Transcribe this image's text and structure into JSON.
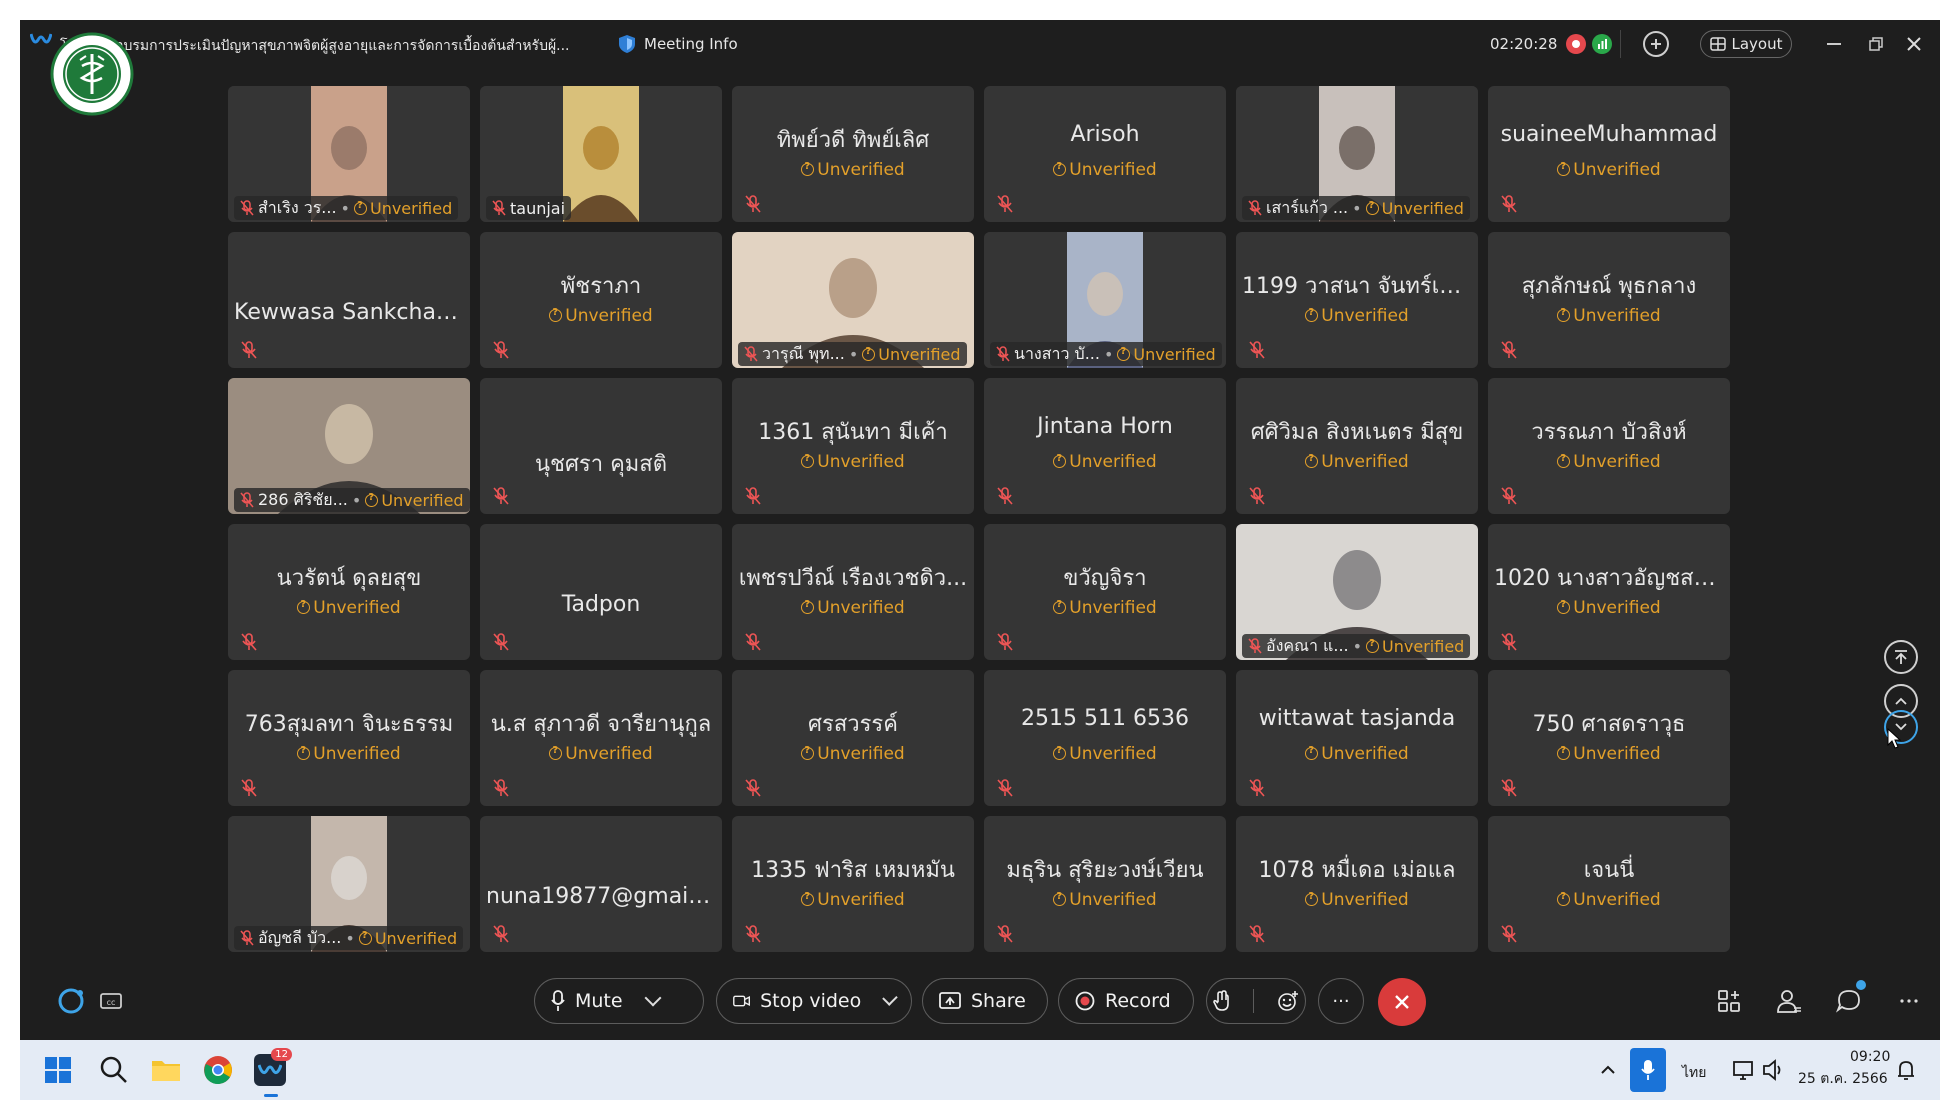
{
  "window": {
    "title": "โครงการอบรมการประเมินปัญหาสุขภาพจิตผู้สูงอายุและการจัดการเบื้องต้นสำหรับผู้...",
    "meeting_info_label": "Meeting Info",
    "timer": "02:20:28",
    "layout_label": "Layout"
  },
  "status_unverified": "Unverified",
  "participants": [
    {
      "name": "สำเริง  วร...",
      "status": "Unverified",
      "video": true
    },
    {
      "name": "taunjai",
      "status": "",
      "video": true
    },
    {
      "name": "ทิพย์วดี ทิพย์เลิศ",
      "status": "Unverified",
      "video": false
    },
    {
      "name": "Arisoh",
      "status": "Unverified",
      "video": false
    },
    {
      "name": "เสาร์แก้ว ...",
      "status": "Unverified",
      "video": true
    },
    {
      "name": "suaineeMuhammad",
      "status": "Unverified",
      "video": false
    },
    {
      "name": "Kewwasa Sankchatt...",
      "status": "",
      "video": false
    },
    {
      "name": "พัชราภา",
      "status": "Unverified",
      "video": false
    },
    {
      "name": "วารุณี พุท...",
      "status": "Unverified",
      "video": true
    },
    {
      "name": "นางสาว บั...",
      "status": "Unverified",
      "video": true
    },
    {
      "name": "1199 วาสนา จันทร์เม...",
      "status": "Unverified",
      "video": false
    },
    {
      "name": "สุภลักษณ์ พุธกลาง",
      "status": "Unverified",
      "video": false
    },
    {
      "name": "286 ศิริชัย...",
      "status": "Unverified",
      "video": true
    },
    {
      "name": "นุชศรา คุมสติ",
      "status": "",
      "video": false
    },
    {
      "name": "1361 สุนันทา มีเค้า",
      "status": "Unverified",
      "video": false
    },
    {
      "name": "Jintana Horn",
      "status": "Unverified",
      "video": false
    },
    {
      "name": "ศศิวิมล สิงหเนตร มีสุข",
      "status": "Unverified",
      "video": false
    },
    {
      "name": "วรรณภา บัวสิงห์",
      "status": "Unverified",
      "video": false
    },
    {
      "name": "นวรัตน์ ดุลยสุข",
      "status": "Unverified",
      "video": false
    },
    {
      "name": "Tadpon",
      "status": "",
      "video": false
    },
    {
      "name": "เพชรปวีณ์ เรืองเวชดิว...",
      "status": "Unverified",
      "video": false
    },
    {
      "name": "ขวัญจิรา",
      "status": "Unverified",
      "video": false
    },
    {
      "name": "อังคณา  แ...",
      "status": "Unverified",
      "video": true
    },
    {
      "name": "1020 นางสาวอัญชสา...",
      "status": "Unverified",
      "video": false
    },
    {
      "name": "763สุมลทา จินะธรรม",
      "status": "Unverified",
      "video": false
    },
    {
      "name": "น.ส สุภาวดี  จารียานุกูล",
      "status": "Unverified",
      "video": false
    },
    {
      "name": "ศรสวรรค์",
      "status": "Unverified",
      "video": false
    },
    {
      "name": "2515 511 6536",
      "status": "Unverified",
      "video": false
    },
    {
      "name": "wittawat tasjanda",
      "status": "Unverified",
      "video": false
    },
    {
      "name": "750 ศาสดราวุธ",
      "status": "Unverified",
      "video": false
    },
    {
      "name": "อัญชลี บัว...",
      "status": "Unverified",
      "video": true
    },
    {
      "name": "nuna19877@gmail....",
      "status": "",
      "video": false
    },
    {
      "name": "1335 ฟาริส เหมหมัน",
      "status": "Unverified",
      "video": false
    },
    {
      "name": "มธุริน สุริยะวงษ์เวียน",
      "status": "Unverified",
      "video": false
    },
    {
      "name": "1078 หมื่เดอ เม่อแล",
      "status": "Unverified",
      "video": false
    },
    {
      "name": "เจนนี่",
      "status": "Unverified",
      "video": false
    }
  ],
  "controls": {
    "mute": "Mute",
    "stop_video": "Stop video",
    "share": "Share",
    "record": "Record",
    "more": "···"
  },
  "taskbar": {
    "language": "ไทย",
    "time": "09:20",
    "date": "25 ต.ค. 2566",
    "webex_badge": "12"
  },
  "colors": {
    "background": "#1e1e1e",
    "tile": "#353535",
    "unverified": "#e3a02a",
    "end_call": "#d93b3b",
    "accent": "#3ea4e8"
  }
}
